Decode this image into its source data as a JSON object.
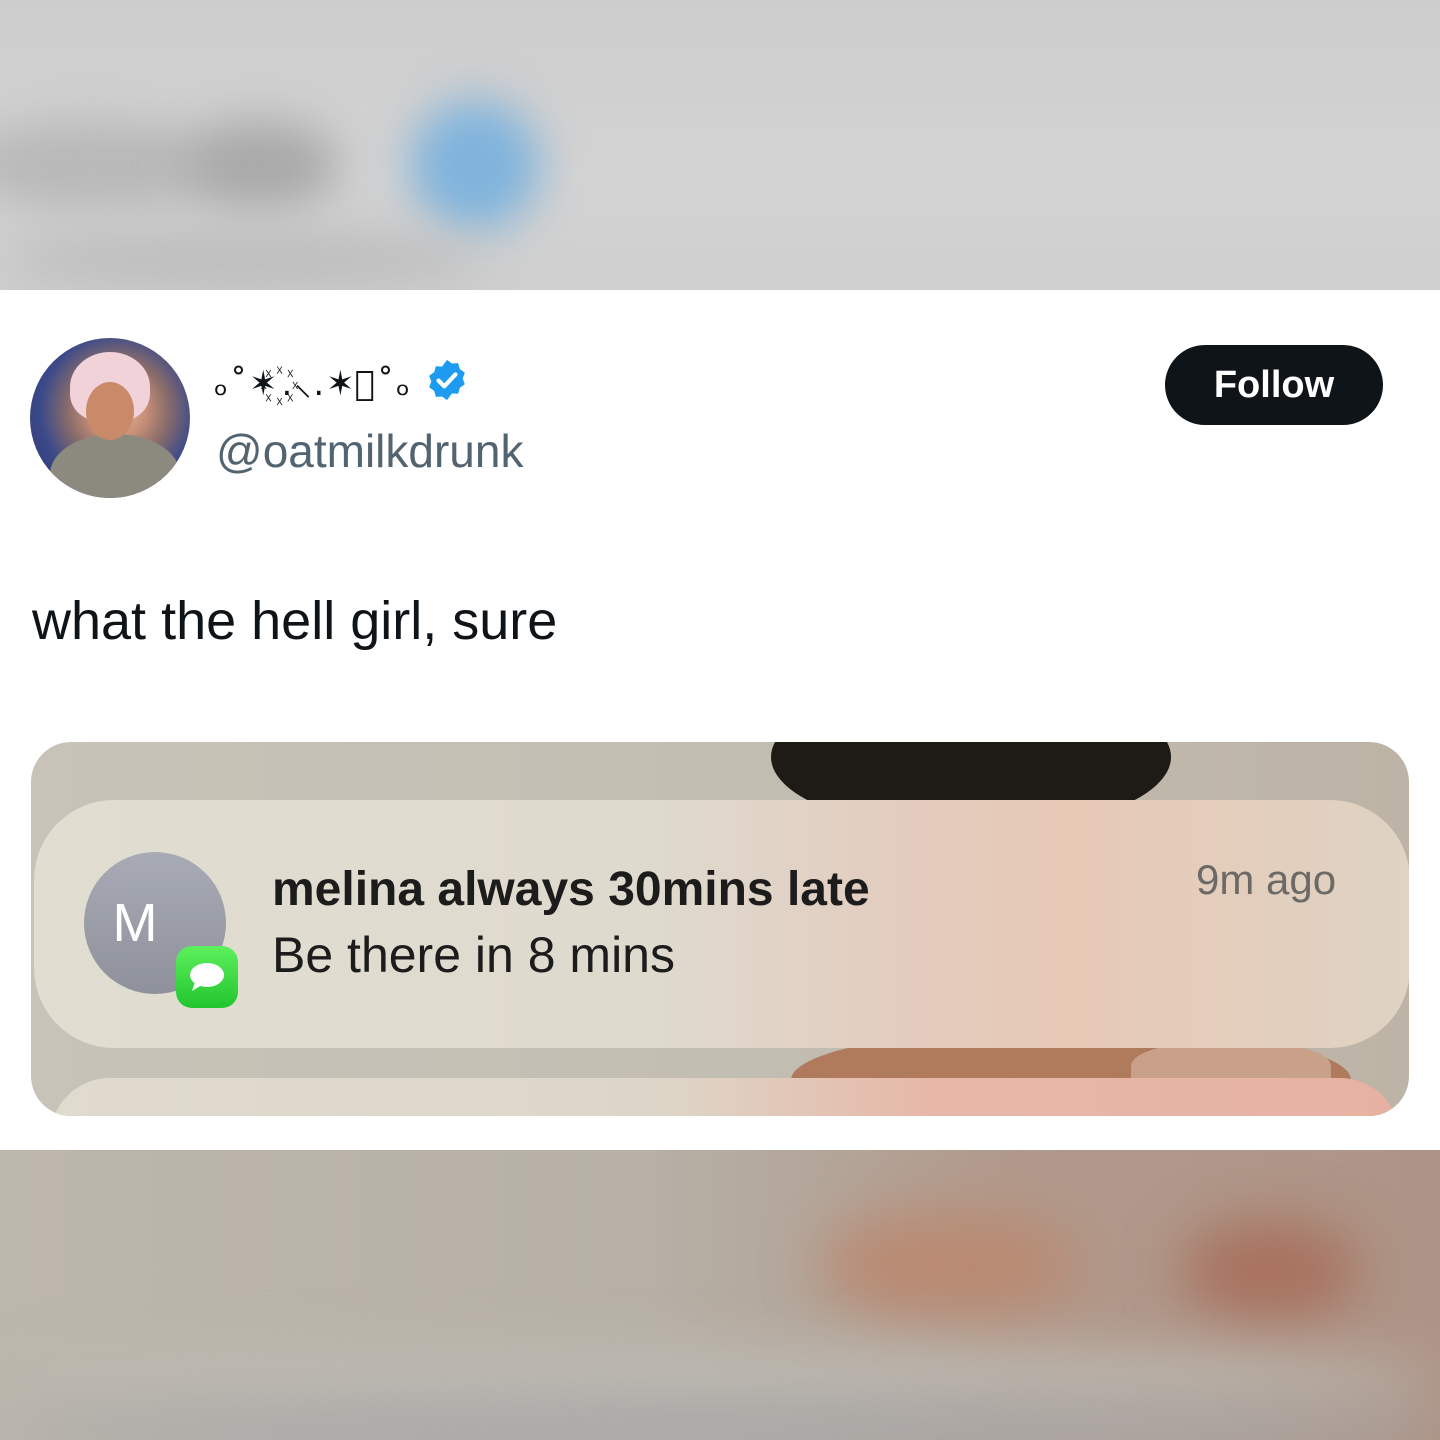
{
  "tweet": {
    "display_name": "ₒ˚✶꙰.⸜.✶꙰˚ₒ",
    "handle": "@oatmilkdrunk",
    "follow_label": "Follow",
    "text": "what the hell girl, sure"
  },
  "notification": {
    "avatar_letter": "M",
    "sender": "melina always 30mins late",
    "message": "Be there in 8 mins",
    "time": "9m ago"
  },
  "colors": {
    "follow_bg": "#0f1419",
    "verified": "#1d9bf0",
    "handle": "#536471",
    "imessage_green": "#22c52e"
  },
  "icons": {
    "verified": "verified-badge-icon",
    "messages": "messages-app-icon"
  }
}
